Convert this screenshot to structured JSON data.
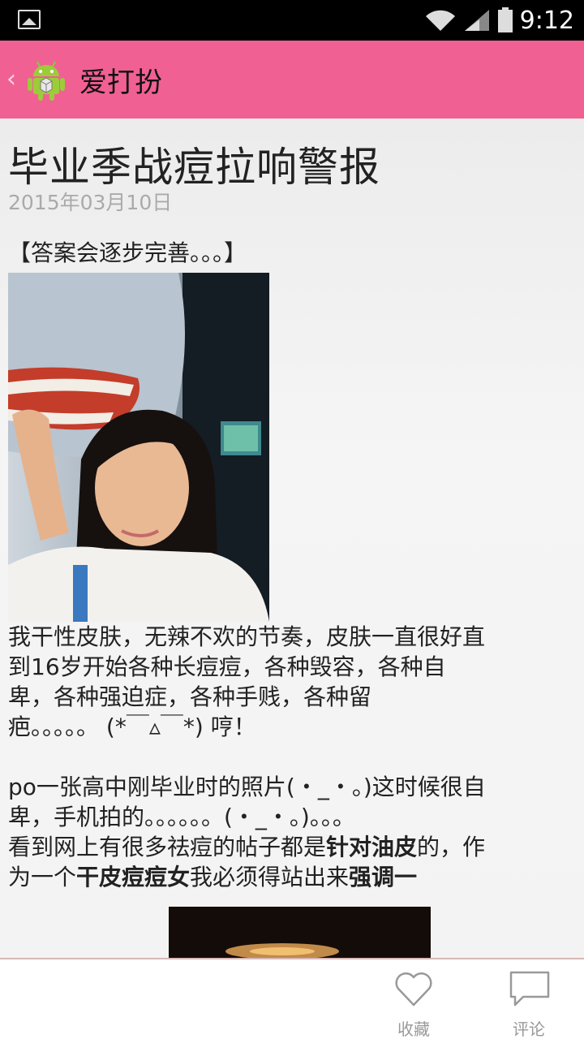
{
  "status_bar": {
    "time": "9:12"
  },
  "action_bar": {
    "back_glyph": "‹",
    "title": "爱打扮"
  },
  "article": {
    "title": "毕业季战痘拉响警报",
    "date": "2015年03月10日",
    "intro": "【答案会逐步完善。。。】",
    "paragraph1_lines": [
      "我干性皮肤，无辣不欢的节奏，皮肤一直很好直",
      "到16岁开始各种长痘痘，各种毁容，各种自",
      "卑，各种强迫症，各种手贱，各种留",
      "疤。。。。。 (*￣▵￣*) 哼！"
    ],
    "paragraph2_lines": [
      "po一张高中刚毕业时的照片(・_・。)这时候很自",
      "卑，手机拍的。。。。。。(・_・。)。。。"
    ],
    "p3_a": "看到网上有很多祛痘的帖子都是",
    "p3_b": "针对油皮",
    "p3_c": "的，作",
    "p3_d": "为一个",
    "p3_e": "干皮痘痘女",
    "p3_f": "我必须得站出来",
    "p3_g": "强调一"
  },
  "bottom_bar": {
    "favorite_label": "收藏",
    "comment_label": "评论"
  },
  "colors": {
    "action_bar": "#f16093",
    "status_bar": "#000000"
  },
  "icons": [
    "gallery-icon",
    "wifi-icon",
    "signal-icon",
    "battery-icon",
    "android-app-icon",
    "heart-icon",
    "comment-icon"
  ]
}
